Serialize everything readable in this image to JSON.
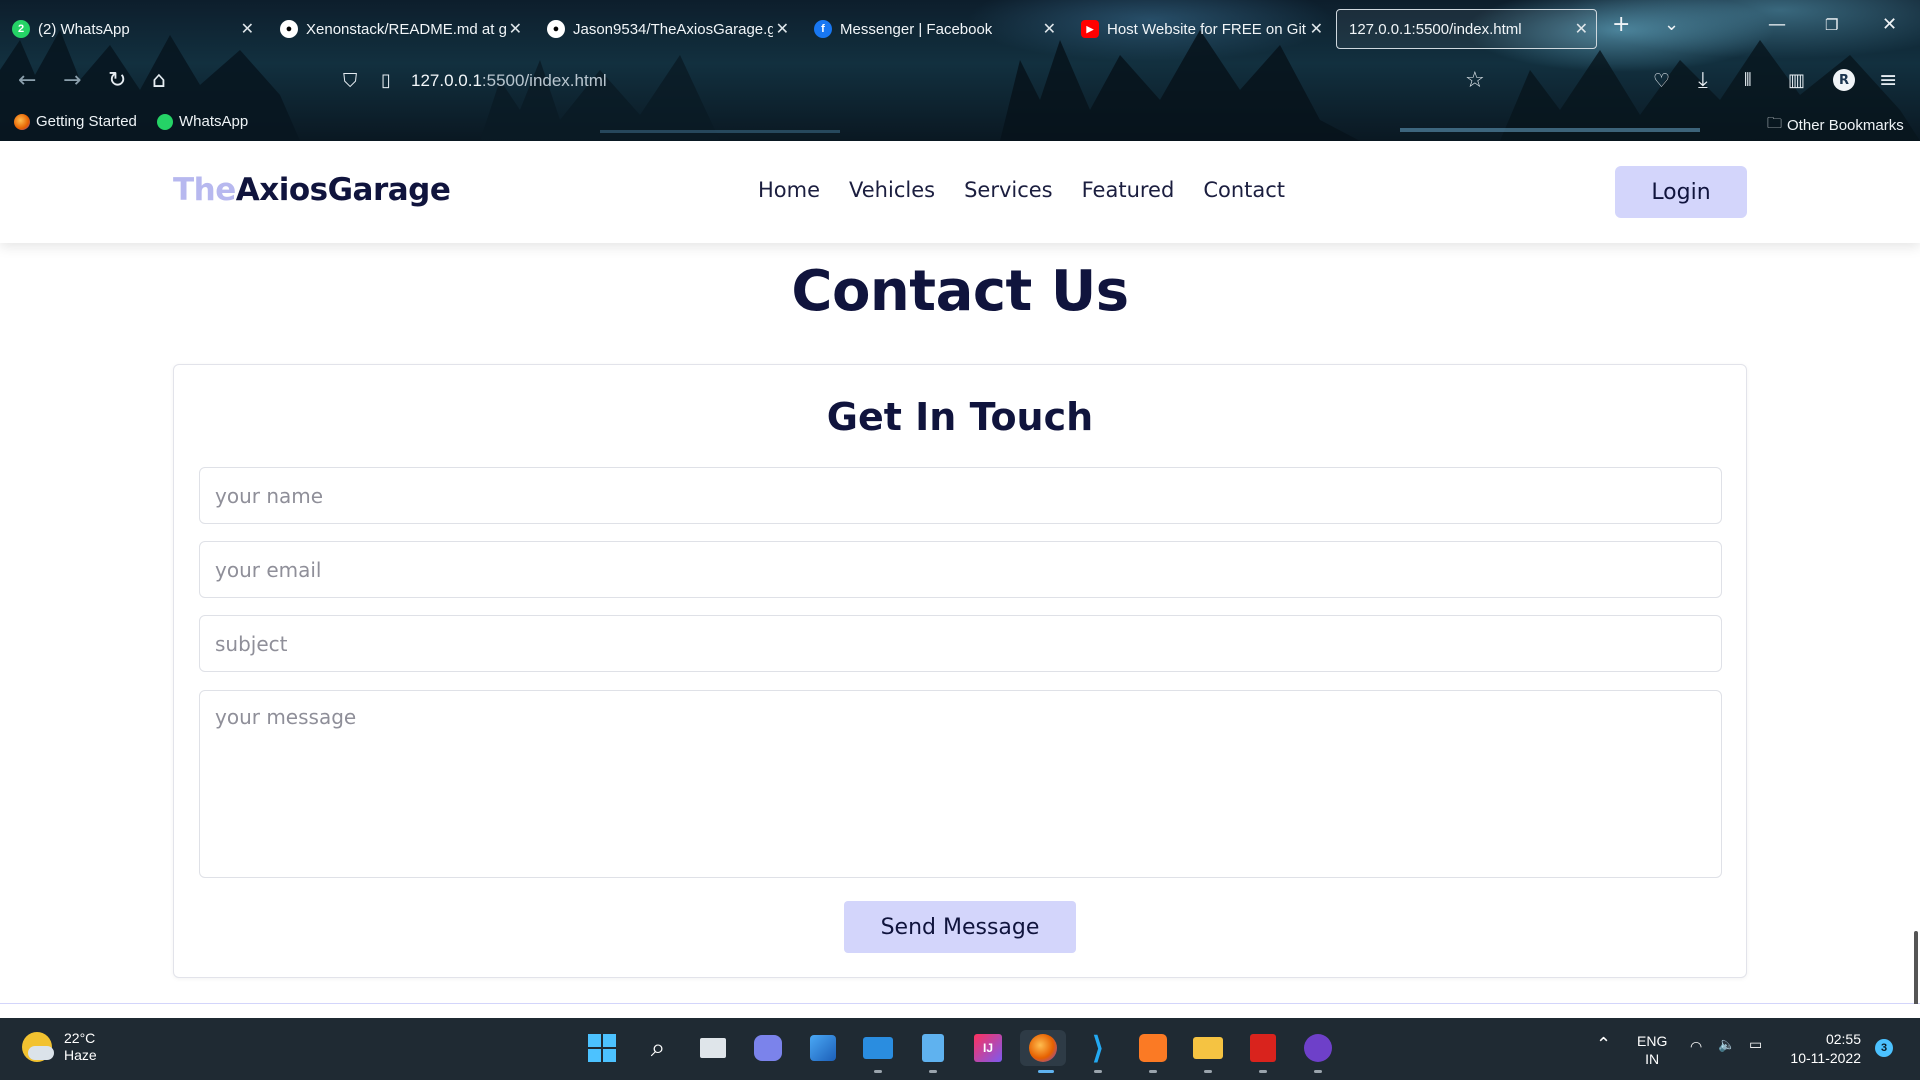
{
  "browser": {
    "tabs": [
      {
        "title": "(2) WhatsApp",
        "icon": "whatsapp-icon",
        "badge": "2"
      },
      {
        "title": "Xenonstack/README.md at g",
        "icon": "github-icon"
      },
      {
        "title": "Jason9534/TheAxiosGarage.g",
        "icon": "github-icon"
      },
      {
        "title": "Messenger | Facebook",
        "icon": "facebook-icon"
      },
      {
        "title": "Host Website for FREE on Git",
        "icon": "youtube-icon"
      },
      {
        "title": "127.0.0.1:5500/index.html",
        "icon": "none",
        "active": true
      }
    ],
    "url": {
      "host": "127.0.0.1",
      "rest": ":5500/index.html"
    },
    "bookmarks": [
      {
        "label": "Getting Started",
        "icon": "firefox-icon"
      },
      {
        "label": "WhatsApp",
        "icon": "whatsapp-icon"
      }
    ],
    "other_bookmarks": "Other Bookmarks",
    "profile_initial": "R"
  },
  "site": {
    "logo": {
      "accent": "The",
      "main": "AxiosGarage"
    },
    "nav": [
      "Home",
      "Vehicles",
      "Services",
      "Featured",
      "Contact"
    ],
    "login_label": "Login",
    "section_title": "Contact Us",
    "form": {
      "title": "Get In Touch",
      "name_placeholder": "your name",
      "email_placeholder": "your email",
      "subject_placeholder": "subject",
      "message_placeholder": "your message",
      "send_label": "Send Message"
    }
  },
  "taskbar": {
    "weather": {
      "temp": "22°C",
      "condition": "Haze"
    },
    "language": {
      "line1": "ENG",
      "line2": "IN"
    },
    "time": "02:55",
    "date": "10-11-2022",
    "notifications": "3"
  },
  "colors": {
    "accent": "#d3d5fb",
    "brand_dark": "#10143d",
    "logo_accent": "#b7b8ef"
  }
}
